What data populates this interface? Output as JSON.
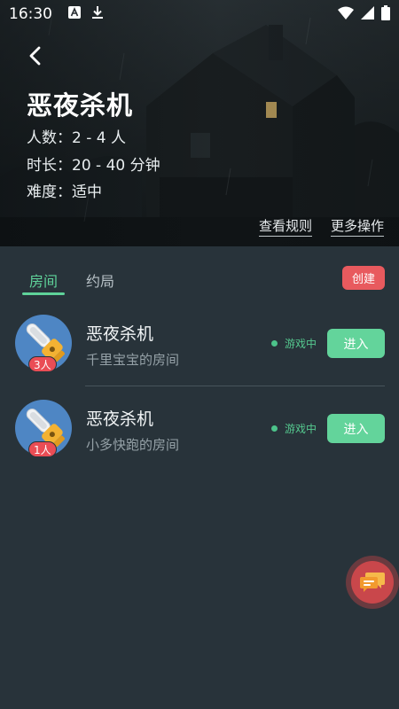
{
  "status_bar": {
    "time": "16:30",
    "icons": [
      "translate-app-icon",
      "download-icon",
      "wifi-icon",
      "signal-icon",
      "battery-icon"
    ]
  },
  "header": {
    "back_icon": "chevron-left-icon",
    "title": "恶夜杀机",
    "players": "人数：2 - 4 人",
    "duration": "时长：20 - 40 分钟",
    "difficulty": "难度：适中",
    "view_rules": "查看规则",
    "more_actions": "更多操作"
  },
  "tabs": {
    "rooms": "房间",
    "appointments": "约局",
    "active": "rooms",
    "create_label": "创建"
  },
  "rooms": [
    {
      "name": "恶夜杀机",
      "owner": "千里宝宝的房间",
      "player_count": "3人",
      "status": "游戏中",
      "join_label": "进入"
    },
    {
      "name": "恶夜杀机",
      "owner": "小多快跑的房间",
      "player_count": "1人",
      "status": "游戏中",
      "join_label": "进入"
    }
  ],
  "floating_button": {
    "icon": "chat-bubbles-icon"
  },
  "colors": {
    "background": "#28333a",
    "accent_green": "#63d49b",
    "create_red": "#e85a5e",
    "badge_red": "#ea4d55",
    "avatar_blue": "#4e86c4",
    "float_red": "#c9474b"
  }
}
